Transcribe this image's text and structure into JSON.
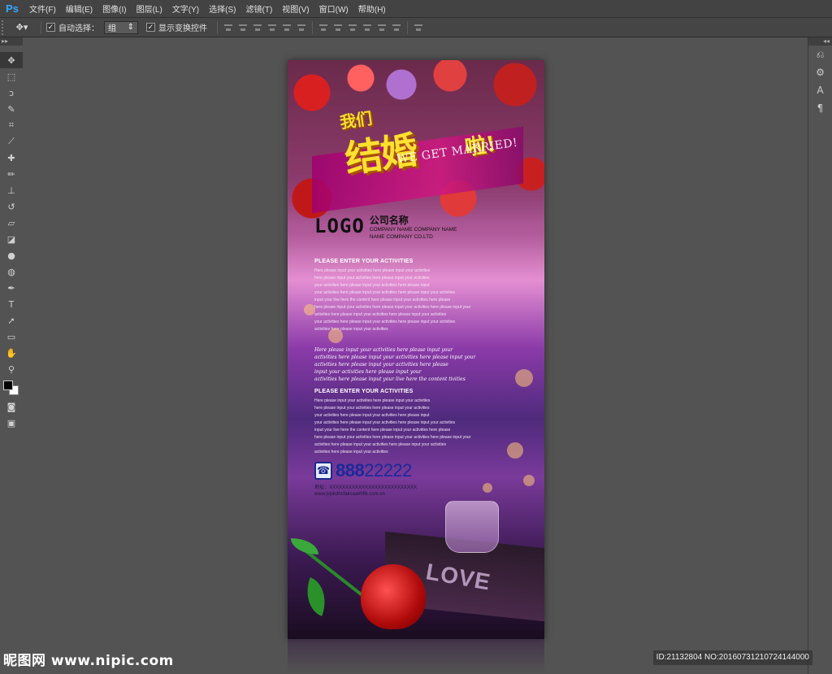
{
  "app": {
    "logo": "Ps"
  },
  "menu": [
    "文件(F)",
    "编辑(E)",
    "图像(I)",
    "图层(L)",
    "文字(Y)",
    "选择(S)",
    "滤镜(T)",
    "视图(V)",
    "窗口(W)",
    "帮助(H)"
  ],
  "options": {
    "auto_select_label": "自动选择：",
    "auto_select_value": "组",
    "show_transform_label": "显示变换控件"
  },
  "toolbox_header": "▸▸",
  "rightpanel_header": "◂◂",
  "poster": {
    "title_small": "我们",
    "title_big": "结婚",
    "title_sub": "啦!",
    "title_en": "WE GET MARRIED!",
    "logo": "LOGO",
    "company_cn": "公司名称",
    "company_en_1": "COMPANY NAME COMPANY NAME",
    "company_en_2": "NAME COMPANY CO.LTD",
    "section1_heading": "PLEASE ENTER YOUR ACTIVITIES",
    "section1_lines": [
      "Here please input your activities here please input your activities",
      "here please input your activities here please input your activities",
      "your activities here please input your activities here please input",
      "your activities here please input your activities here please input your activities",
      "input your live here the content here please input your activities here please",
      "here please input your activities here please input your activities here please input your",
      "activities here please input your activities here please input your activities",
      "your activities here please input your activities here please input your activities",
      "activities here please input your activities"
    ],
    "script_lines": [
      "Here please input your activities here please input your",
      "activities here please input your activities here please input your",
      "activities here please input your activities here please",
      "input your activities here please input your",
      "activities here please input your live here the content tivities"
    ],
    "section2_heading": "PLEASE ENTER YOUR ACTIVITIES",
    "section2_lines": [
      "Here please input your activities here please input your activities",
      "here please input your activities here please input your activities",
      "your activities here please input your activities here please input",
      "your activities here please input your activities here please input your activities",
      "input your live here the content here please input your activities here please",
      "here please input your activities here please input your activities here please input your",
      "activities here please input your activities here please input your activities",
      "activities here please input your activities"
    ],
    "phone_prefix": "888",
    "phone_suffix": "22222",
    "address": "地址：XXXXXXXXXXXXXXXXXXXXXXXXXXX",
    "website": "www.jvjskdhsfaksaakhfik.com.cn",
    "book_word": "LOVE"
  },
  "watermark": {
    "left": "昵图网 www.nipic.com",
    "right": "ID:21132804 NO:20160731210724144000"
  }
}
